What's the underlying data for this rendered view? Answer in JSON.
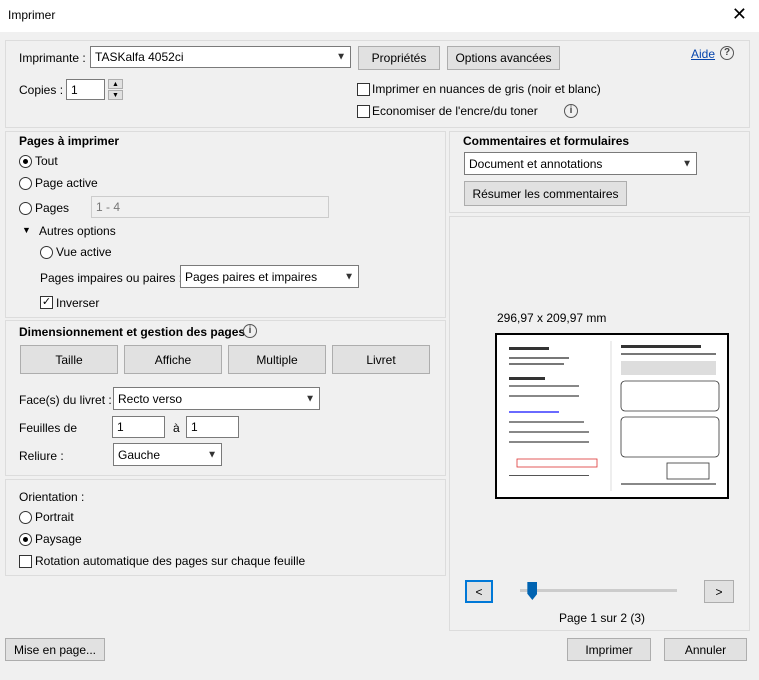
{
  "window": {
    "title": "Imprimer",
    "close_glyph": "✕"
  },
  "printer": {
    "label": "Imprimante :",
    "selected": "TASKalfa 4052ci",
    "properties_label": "Propriétés",
    "advanced_label": "Options avancées",
    "help_label": "Aide",
    "copies_label": "Copies :",
    "copies_value": "1",
    "grayscale_label": "Imprimer en nuances de gris (noir et blanc)",
    "save_ink_label": "Economiser de l'encre/du toner"
  },
  "pages": {
    "heading": "Pages à imprimer",
    "all_label": "Tout",
    "current_label": "Page active",
    "pages_label": "Pages",
    "pages_value": "1 - 4",
    "more_options_label": "Autres options",
    "current_view_label": "Vue active",
    "odd_even_label": "Pages impaires ou paires :",
    "odd_even_value": "Pages paires et impaires",
    "reverse_label": "Inverser"
  },
  "sizing": {
    "heading": "Dimensionnement et gestion des pages",
    "tabs": [
      "Taille",
      "Affiche",
      "Multiple",
      "Livret"
    ],
    "sides_label": "Face(s) du livret :",
    "sides_value": "Recto verso",
    "sheets_label": "Feuilles de",
    "sheets_from": "1",
    "sheets_to_label": "à",
    "sheets_to": "1",
    "binding_label": "Reliure :",
    "binding_value": "Gauche"
  },
  "orientation": {
    "heading": "Orientation :",
    "portrait_label": "Portrait",
    "landscape_label": "Paysage",
    "auto_rotate_label": "Rotation automatique des pages sur chaque feuille"
  },
  "comments": {
    "heading": "Commentaires et formulaires",
    "selected": "Document et annotations",
    "summarize_label": "Résumer les commentaires"
  },
  "preview": {
    "size_text": "296,97 x 209,97 mm",
    "page_status": "Page 1 sur 2 (3)",
    "prev_glyph": "<",
    "next_glyph": ">",
    "position_fraction": 0.05
  },
  "footer": {
    "page_setup_label": "Mise en page...",
    "print_label": "Imprimer",
    "cancel_label": "Annuler"
  }
}
